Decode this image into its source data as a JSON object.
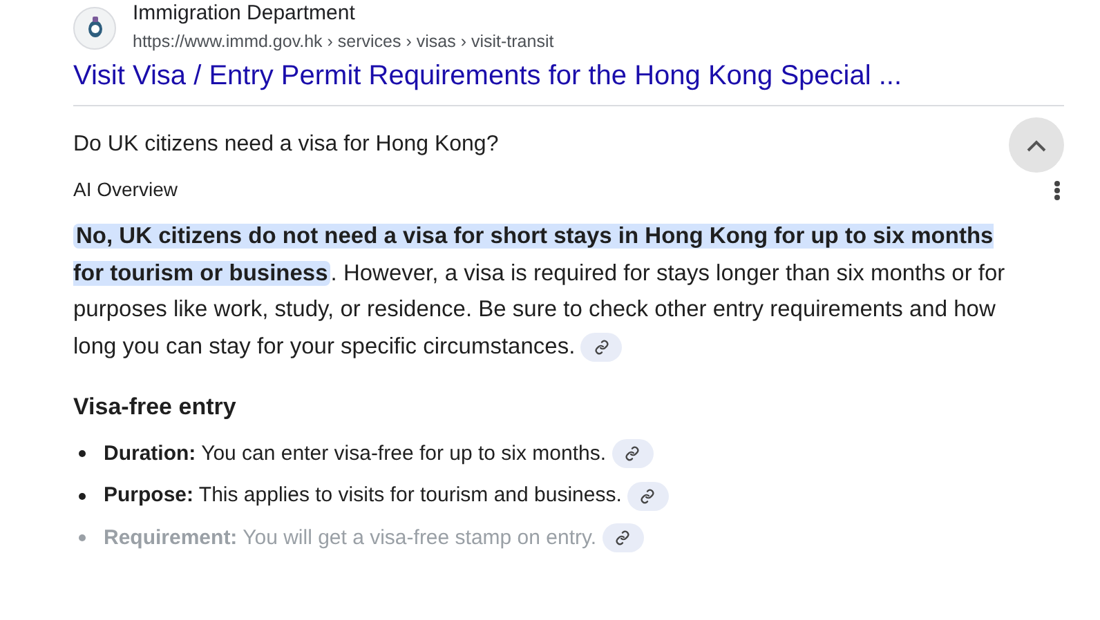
{
  "result": {
    "site_name": "Immigration Department",
    "url": "https://www.immd.gov.hk › services › visas › visit-transit",
    "title": "Visit Visa / Entry Permit Requirements for the Hong Kong Special ..."
  },
  "question": {
    "text": "Do UK citizens need a visa for Hong Kong?",
    "expanded": true
  },
  "overview": {
    "label": "AI Overview",
    "highlight": "No, UK citizens do not need a visa for short stays in Hong Kong for up to six months for tourism or business",
    "body": ". However, a visa is required for stays longer than six months or for purposes like work, study, or residence. Be sure to check other entry requirements and how long you can stay for your specific circumstances.",
    "heading": "Visa-free entry",
    "items": [
      {
        "term": "Duration:",
        "text": "You can enter visa-free for up to six months.",
        "faded": false
      },
      {
        "term": "Purpose:",
        "text": "This applies to visits for tourism and business.",
        "faded": false
      },
      {
        "term": "Requirement:",
        "text": "You will get a visa-free stamp on entry.",
        "faded": true
      }
    ]
  }
}
